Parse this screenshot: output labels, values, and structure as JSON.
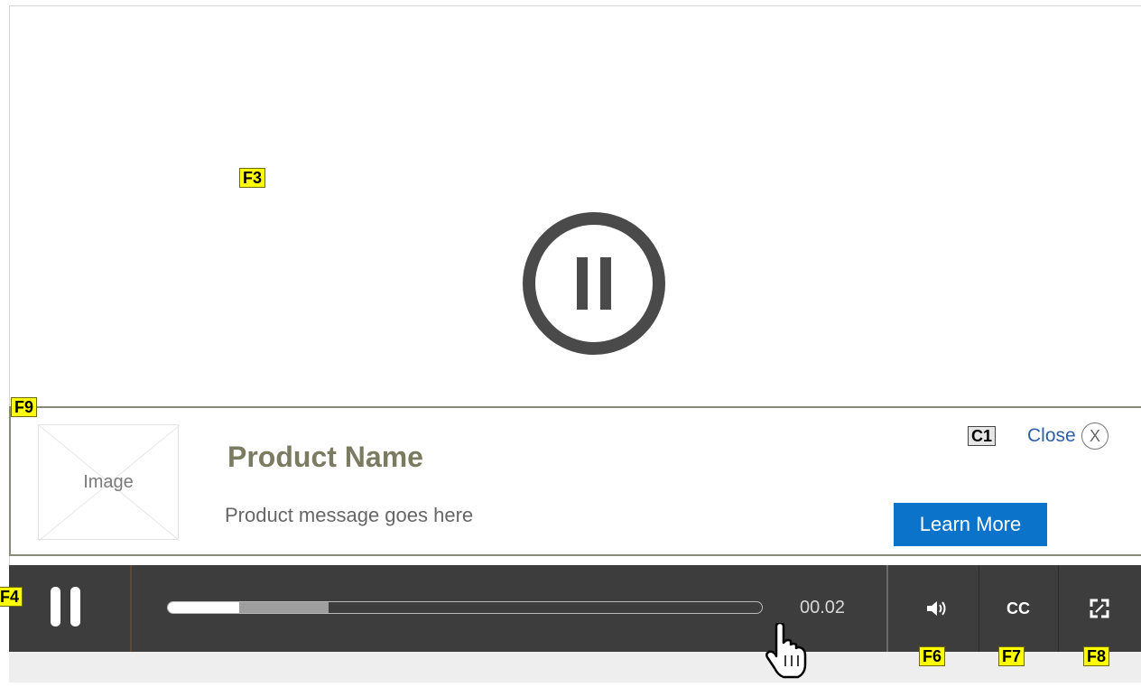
{
  "annotations": {
    "f3": "F3",
    "f9": "F9",
    "f4": "F4",
    "f6": "F6",
    "f7": "F7",
    "f8": "F8",
    "c1": "C1"
  },
  "promo": {
    "image_label": "Image",
    "product_name": "Product Name",
    "product_message": "Product message goes here",
    "close_label": "Close",
    "close_icon_glyph": "X",
    "cta_label": "Learn More",
    "cta_color": "#0b73c9"
  },
  "player": {
    "state": "paused",
    "time_display": "00.02",
    "played_fraction": 0.12,
    "buffered_fraction": 0.27,
    "cc_label": "CC",
    "controls": [
      "pause-icon",
      "volume-icon",
      "closed-captions-icon",
      "fullscreen-icon"
    ]
  },
  "colors": {
    "control_bar": "#3d3d3d",
    "product_name": "#7b7b62",
    "annotation_tag": "#ffff00"
  }
}
